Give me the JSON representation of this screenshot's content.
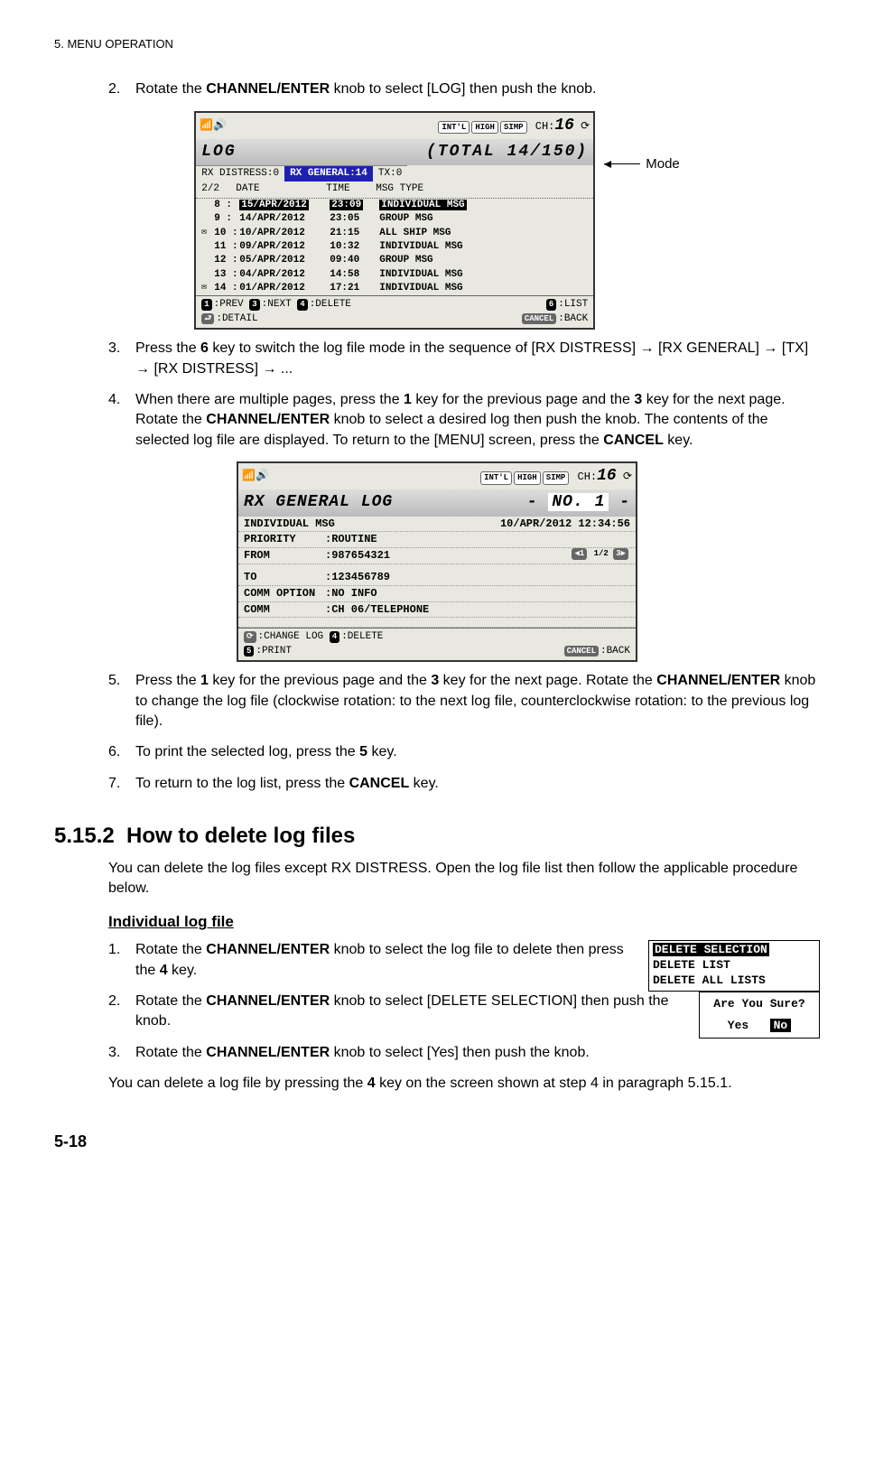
{
  "header": {
    "chapter": "5.  MENU OPERATION"
  },
  "step2": {
    "num": "2.",
    "pre": "Rotate the ",
    "kb": "CHANNEL/ENTER",
    "post": " knob to select [LOG] then push the knob."
  },
  "fig1": {
    "intl": "INT'L",
    "high": "HIGH",
    "simp": "SIMP",
    "chlabel": "CH:",
    "ch": "16",
    "title_left": "LOG",
    "title_right": "(TOTAL  14/150)",
    "tab1": "RX DISTRESS:0",
    "tab2": "RX GENERAL:14",
    "tab3": "TX:0",
    "col_pg": "2/2",
    "col_date": "DATE",
    "col_time": "TIME",
    "col_msg": "MSG TYPE",
    "rows": [
      {
        "icon": "",
        "idx": "8 :",
        "date": "15/APR/2012",
        "time": "23:09",
        "msg": "INDIVIDUAL MSG",
        "sel": true
      },
      {
        "icon": "",
        "idx": "9 :",
        "date": "14/APR/2012",
        "time": "23:05",
        "msg": "GROUP MSG",
        "sel": false
      },
      {
        "icon": "✉",
        "idx": "10 :",
        "date": "10/APR/2012",
        "time": "21:15",
        "msg": "ALL SHIP MSG",
        "sel": false
      },
      {
        "icon": "",
        "idx": "11 :",
        "date": "09/APR/2012",
        "time": "10:32",
        "msg": "INDIVIDUAL MSG",
        "sel": false
      },
      {
        "icon": "",
        "idx": "12 :",
        "date": "05/APR/2012",
        "time": "09:40",
        "msg": "GROUP MSG",
        "sel": false
      },
      {
        "icon": "",
        "idx": "13 :",
        "date": "04/APR/2012",
        "time": "14:58",
        "msg": "INDIVIDUAL MSG",
        "sel": false
      },
      {
        "icon": "✉",
        "idx": "14 :",
        "date": "01/APR/2012",
        "time": "17:21",
        "msg": "INDIVIDUAL MSG",
        "sel": false
      }
    ],
    "f1k": "1",
    "f1": ":PREV",
    "f3k": "3",
    "f3": ":NEXT",
    "f4k": "4",
    "f4": ":DELETE",
    "f6k": "6",
    "f6": ":LIST",
    "fentk": "⮐",
    "fent": ":DETAIL",
    "fcank": "CANCEL",
    "fcan": ":BACK",
    "mode_label": "Mode"
  },
  "step3": {
    "num": "3.",
    "t1": "Press the ",
    "k1": "6",
    "t2": " key to switch the log file mode in the sequence of [RX DISTRESS] → [RX GENERAL] → [TX] → [RX DISTRESS] → ..."
  },
  "step4": {
    "num": "4.",
    "t1": "When there are multiple pages, press the ",
    "k1": "1",
    "t2": " key for the previous page and the ",
    "k2": "3",
    "t3": " key for the next page. Rotate the ",
    "k3": "CHANNEL/ENTER",
    "t4": " knob to select a desired log then push the knob. The contents of the selected log file are displayed. To return to the [MENU] screen, press the ",
    "k4": "CANCEL",
    "t5": " key."
  },
  "fig2": {
    "intl": "INT'L",
    "high": "HIGH",
    "simp": "SIMP",
    "chlabel": "CH:",
    "ch": "16",
    "title_left": "RX GENERAL  LOG",
    "title_mid": "-",
    "title_no": "NO. 1",
    "title_end": "-",
    "l1_left": "INDIVIDUAL MSG",
    "l1_right": "10/APR/2012 12:34:56",
    "l2_lab": "PRIORITY",
    "l2_val": ":ROUTINE",
    "l3_lab": "FROM",
    "l3_val": ":987654321",
    "l3_pg_l": "◀1",
    "l3_pg": "1/2",
    "l3_pg_r": "3▶",
    "l4_lab": "TO",
    "l4_val": ":123456789",
    "l5_lab": "COMM OPTION",
    "l5_val": ":NO INFO",
    "l6_lab": "COMM",
    "l6_val": ":CH 06/TELEPHONE",
    "f_knob": "⟳",
    "f_knob_t": ":CHANGE LOG",
    "f4k": "4",
    "f4t": ":DELETE",
    "f5k": "5",
    "f5t": ":PRINT",
    "fcank": "CANCEL",
    "fcant": ":BACK"
  },
  "step5": {
    "num": "5.",
    "t1": "Press the ",
    "k1": "1",
    "t2": " key for the previous page and the ",
    "k2": "3",
    "t3": " key for the next page. Rotate the ",
    "k3": "CHANNEL/ENTER",
    "t4": " knob to change the log file (clockwise rotation: to the next log file, counterclockwise rotation: to the previous log file)."
  },
  "step6": {
    "num": "6.",
    "t1": "To print the selected log, press the ",
    "k1": "5",
    "t2": " key."
  },
  "step7": {
    "num": "7.",
    "t1": "To return to the log list, press the ",
    "k1": "CANCEL",
    "t2": " key."
  },
  "section": {
    "num": "5.15.2",
    "title": "How to delete log files"
  },
  "sec_intro": "You can delete the log files except RX DISTRESS. Open the log file list then follow the applicable procedure below.",
  "subhead": "Individual log file",
  "dstep1": {
    "num": "1.",
    "t1": "Rotate the ",
    "k1": "CHANNEL/ENTER",
    "t2": " knob to select the log file to delete then press the ",
    "k2": "4",
    "t3": " key."
  },
  "box1": {
    "l1": "DELETE SELECTION",
    "l2": "DELETE LIST",
    "l3": "DELETE ALL LISTS"
  },
  "dstep2": {
    "num": "2.",
    "t1": "Rotate the ",
    "k1": "CHANNEL/ENTER",
    "t2": " knob to select [DELETE SELECTION] then push the knob."
  },
  "box2": {
    "l1": "Are You Sure?",
    "yes": "Yes",
    "no": "No"
  },
  "dstep3": {
    "num": "3.",
    "t1": "Rotate the ",
    "k1": "CHANNEL/ENTER",
    "t2": " knob to select [Yes] then push the knob."
  },
  "tail": {
    "t1": "You can delete a log file by pressing the ",
    "k1": "4",
    "t2": " key on the screen shown at step 4 in paragraph 5.15.1."
  },
  "pagenum": "5-18"
}
